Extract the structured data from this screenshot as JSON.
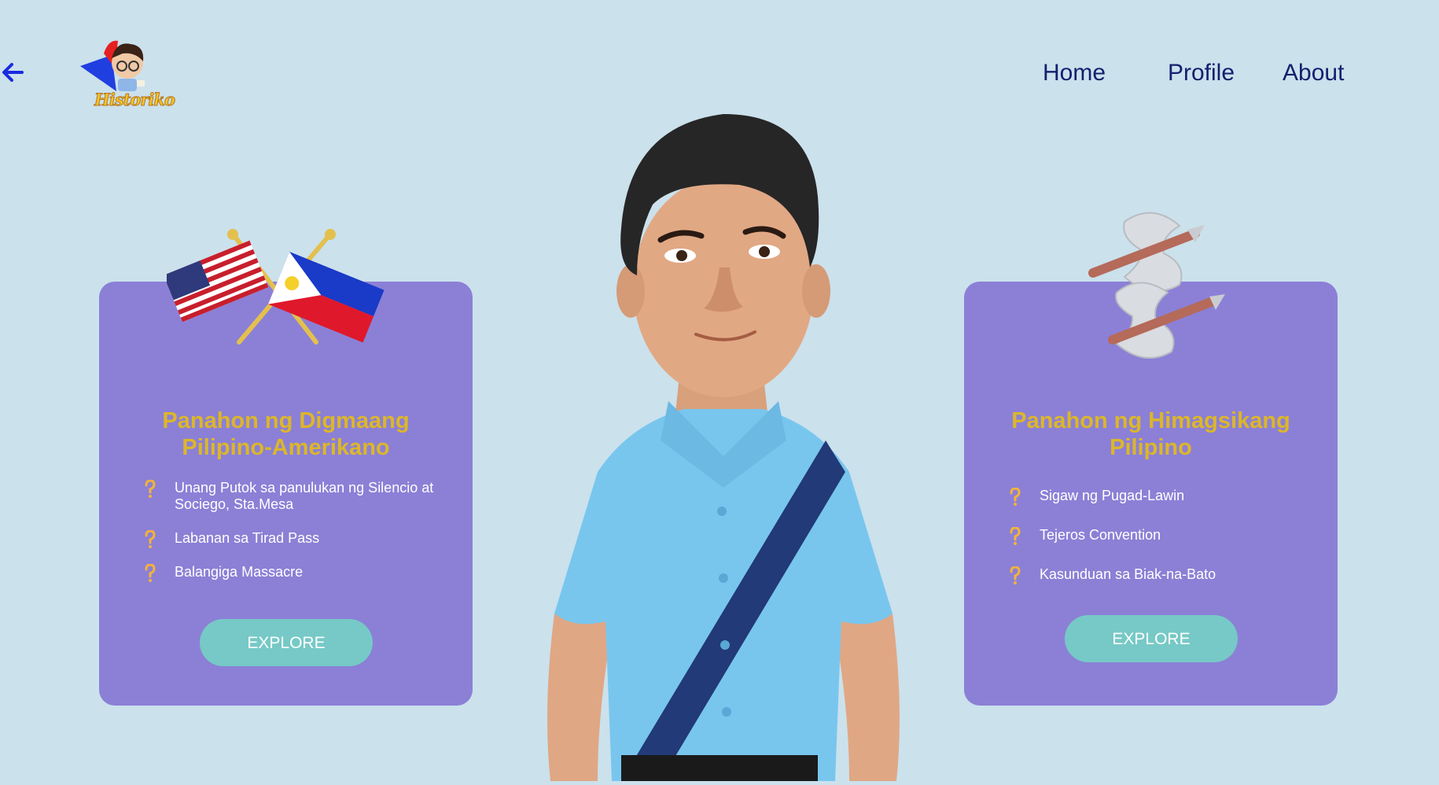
{
  "brand": {
    "name": "Historiko"
  },
  "nav": {
    "home": "Home",
    "profile": "Profile",
    "about": "About",
    "back_icon": "arrow-left-icon"
  },
  "cards": [
    {
      "title": "Panahon ng Digmaang Pilipino-Amerikano",
      "image": "crossed-flags-usa-philippines",
      "items": [
        "Unang Putok sa panulukan ng Silencio at Sociego, Sta.Mesa",
        "Labanan sa Tirad Pass",
        "Balangiga Massacre"
      ],
      "button": "EXPLORE"
    },
    {
      "title": "Panahon ng Himagsikang Pilipino",
      "image": "crossed-battle-axes",
      "items": [
        "Sigaw ng Pugad-Lawin",
        "Tejeros Convention",
        "Kasunduan sa Biak-na-Bato"
      ],
      "button": "EXPLORE"
    }
  ],
  "colors": {
    "background": "#cbe1ec",
    "card": "#8b80d6",
    "title": "#dcb62a",
    "button": "#76c9c6",
    "nav_text": "#14206e"
  }
}
